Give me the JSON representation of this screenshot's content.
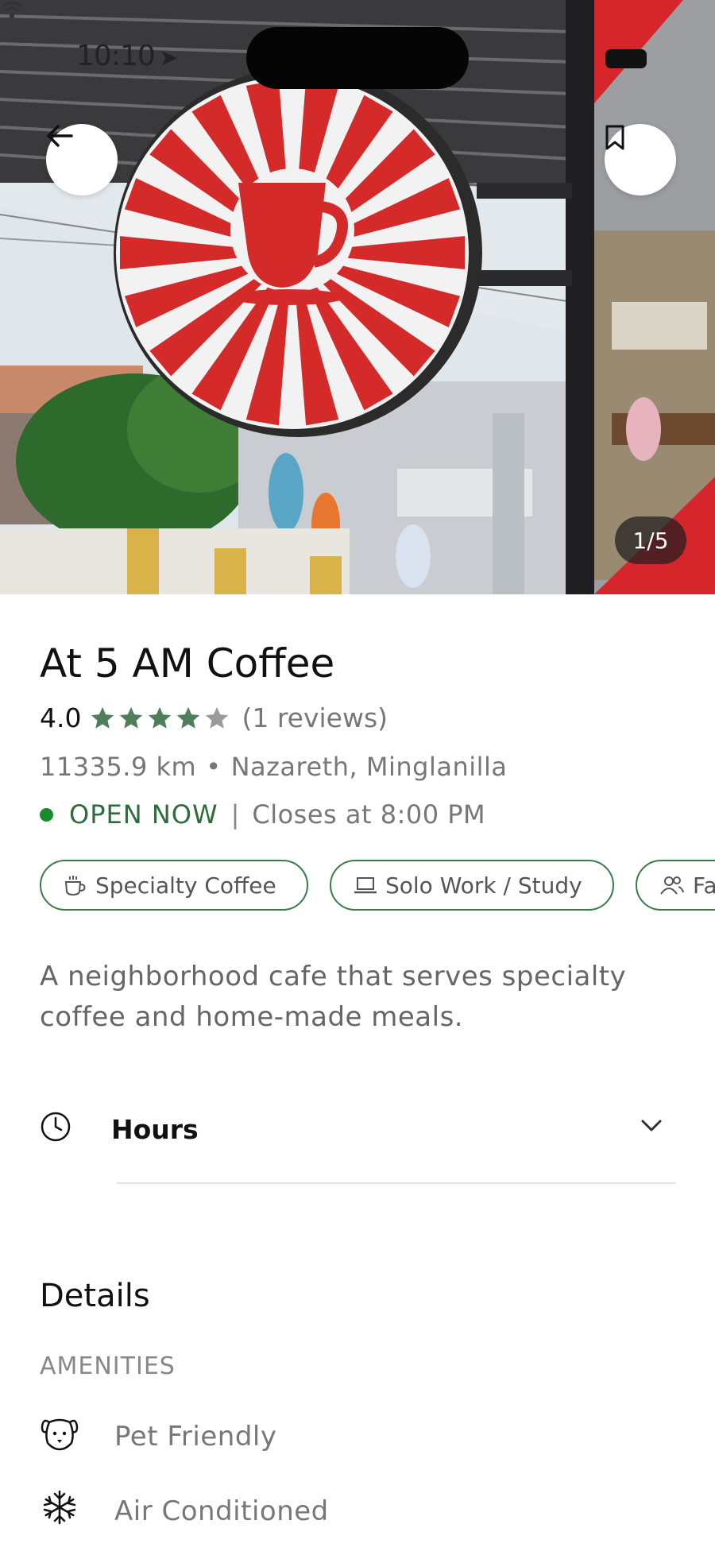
{
  "status_bar": {
    "time": "10:10"
  },
  "hero": {
    "counter": "1/5"
  },
  "place": {
    "name": "At 5 AM Coffee",
    "rating": "4.0",
    "rating_value": 4.0,
    "rating_max": 5,
    "reviews": "(1 reviews)",
    "distance": "11335.9 km",
    "location": "Nazareth, Minglanilla",
    "open_status": "OPEN NOW",
    "closes": "Closes at 8:00 PM",
    "description": "A neighborhood cafe that serves specialty coffee and home-made meals."
  },
  "tags": [
    {
      "label": "Specialty Coffee",
      "icon": "coffee-cup-icon"
    },
    {
      "label": "Solo Work / Study",
      "icon": "laptop-icon"
    },
    {
      "label": "Fa",
      "icon": "people-icon"
    }
  ],
  "hours": {
    "label": "Hours"
  },
  "details": {
    "title": "Details",
    "amenities_label": "AMENITIES",
    "amenities": [
      {
        "label": "Pet Friendly",
        "icon": "dog-icon"
      },
      {
        "label": "Air Conditioned",
        "icon": "snowflake-icon"
      }
    ]
  },
  "colors": {
    "accent_green": "#3b7a4a",
    "star_filled": "#4f7f5a",
    "star_empty": "#9a9a9a",
    "open_dot": "#1b8a2e"
  }
}
